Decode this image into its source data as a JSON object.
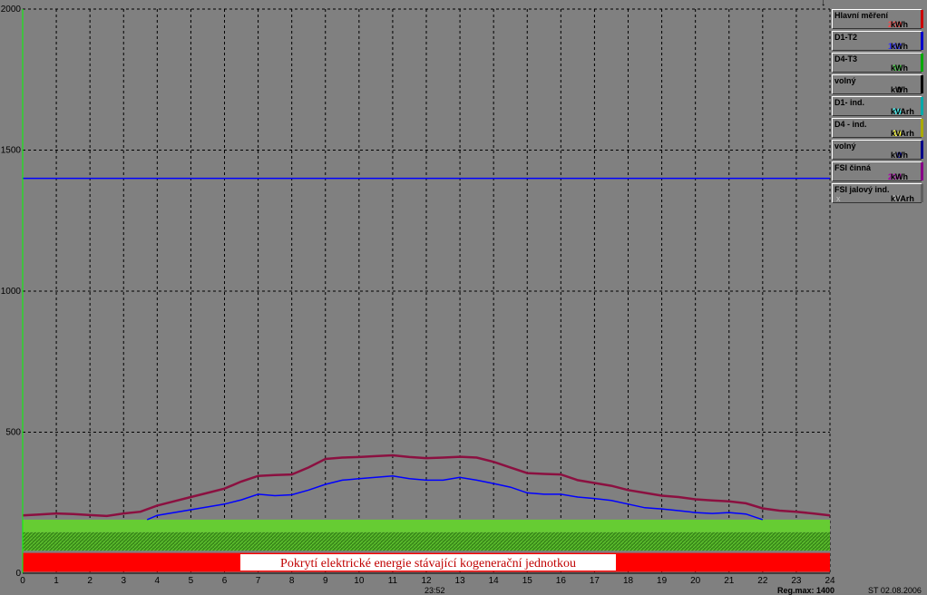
{
  "chart_data": {
    "type": "line",
    "x_range": [
      0,
      24
    ],
    "y_range": [
      0,
      2000
    ],
    "x_ticks": [
      "0",
      "1",
      "2",
      "3",
      "4",
      "5",
      "6",
      "7",
      "8",
      "9",
      "10",
      "11",
      "12",
      "13",
      "14",
      "15",
      "16",
      "17",
      "18",
      "19",
      "20",
      "21",
      "22",
      "23",
      "24"
    ],
    "y_ticks": [
      "0",
      "500",
      "1000",
      "1500",
      "2000"
    ],
    "reg_max": 1400,
    "series": [
      {
        "name": "Hlavní měření",
        "color": "#8b1040",
        "x": [
          0,
          0.5,
          1,
          1.5,
          2,
          2.5,
          3,
          3.5,
          4,
          4.5,
          5,
          5.5,
          6,
          6.5,
          7,
          7.5,
          8,
          8.5,
          9,
          9.5,
          10,
          10.5,
          11,
          11.5,
          12,
          12.5,
          13,
          13.5,
          14,
          14.5,
          15,
          15.5,
          16,
          16.5,
          17,
          17.5,
          18,
          18.5,
          19,
          19.5,
          20,
          20.5,
          21,
          21.5,
          22,
          22.5,
          23,
          23.5,
          24
        ],
        "y": [
          205,
          208,
          212,
          210,
          206,
          203,
          212,
          218,
          240,
          255,
          270,
          285,
          300,
          325,
          345,
          348,
          350,
          375,
          405,
          410,
          412,
          415,
          418,
          412,
          408,
          410,
          413,
          410,
          395,
          375,
          355,
          352,
          350,
          330,
          320,
          310,
          295,
          285,
          275,
          270,
          262,
          258,
          255,
          248,
          230,
          222,
          218,
          212,
          205
        ]
      },
      {
        "name": "D1-T2",
        "color": "#0000ff",
        "x": [
          3.7,
          4,
          4.5,
          5,
          5.5,
          6,
          6.5,
          7,
          7.5,
          8,
          8.5,
          9,
          9.5,
          10,
          10.5,
          11,
          11.5,
          12,
          12.5,
          13,
          13.5,
          14,
          14.5,
          15,
          15.5,
          16,
          16.5,
          17,
          17.5,
          18,
          18.5,
          19,
          19.5,
          20,
          20.5,
          21,
          21.5,
          22
        ],
        "y": [
          190,
          205,
          215,
          225,
          235,
          245,
          260,
          280,
          275,
          278,
          295,
          315,
          330,
          335,
          340,
          345,
          335,
          330,
          330,
          340,
          330,
          318,
          305,
          285,
          280,
          280,
          270,
          265,
          258,
          245,
          232,
          228,
          222,
          215,
          212,
          215,
          210,
          190
        ]
      }
    ],
    "bands": [
      {
        "label": "",
        "color": "#66cc33",
        "y_from": 145,
        "y_to": 190,
        "x_from": 0,
        "x_to": 24
      },
      {
        "label": "",
        "color": "#3a8a1a",
        "y_from": 80,
        "y_to": 145,
        "x_from": 0,
        "x_to": 24
      },
      {
        "label": "Pokrytí elektrické energie stávající kogenerační jednotkou",
        "color": "#ff0000",
        "y_from": 5,
        "y_to": 72,
        "x_from": 0,
        "x_to": 24
      }
    ]
  },
  "legend": [
    {
      "name": "Hlavní měření",
      "value": "200",
      "unit": "kWh",
      "value_color": "#ff4444",
      "bar_color": "#cc0000"
    },
    {
      "name": "D1-T2",
      "value": "162",
      "unit": "kWh",
      "value_color": "#3333ff",
      "bar_color": "#0000cc"
    },
    {
      "name": "D4-T3",
      "value": "38",
      "unit": "kWh",
      "value_color": "#33cc33",
      "bar_color": "#00aa00"
    },
    {
      "name": "volný",
      "value": "0",
      "unit": "kWh",
      "value_color": "#000000",
      "bar_color": "#000000"
    },
    {
      "name": "D1- ind.",
      "value": "56",
      "unit": "kVArh",
      "value_color": "#33ffff",
      "bar_color": "#00aaaa"
    },
    {
      "name": "D4 - ind.",
      "value": "14",
      "unit": "kVArh",
      "value_color": "#ffff33",
      "bar_color": "#aaaa00"
    },
    {
      "name": "volný",
      "value": "0",
      "unit": "kWh",
      "value_color": "#0000aa",
      "bar_color": "#000088"
    },
    {
      "name": "FSI činná",
      "value": "204",
      "unit": "kWh",
      "value_color": "#aa00aa",
      "bar_color": "#880088"
    },
    {
      "name": "FSI jalový ind.",
      "value": "77",
      "unit": "kVArh",
      "value_color": "#c0c0c0",
      "bar_color": "#606060",
      "prefix": "x"
    }
  ],
  "footer": {
    "time": "23:52",
    "reg_max": "Reg.max: 1400",
    "date": "ST  02.08.2006"
  },
  "marker": "↓"
}
